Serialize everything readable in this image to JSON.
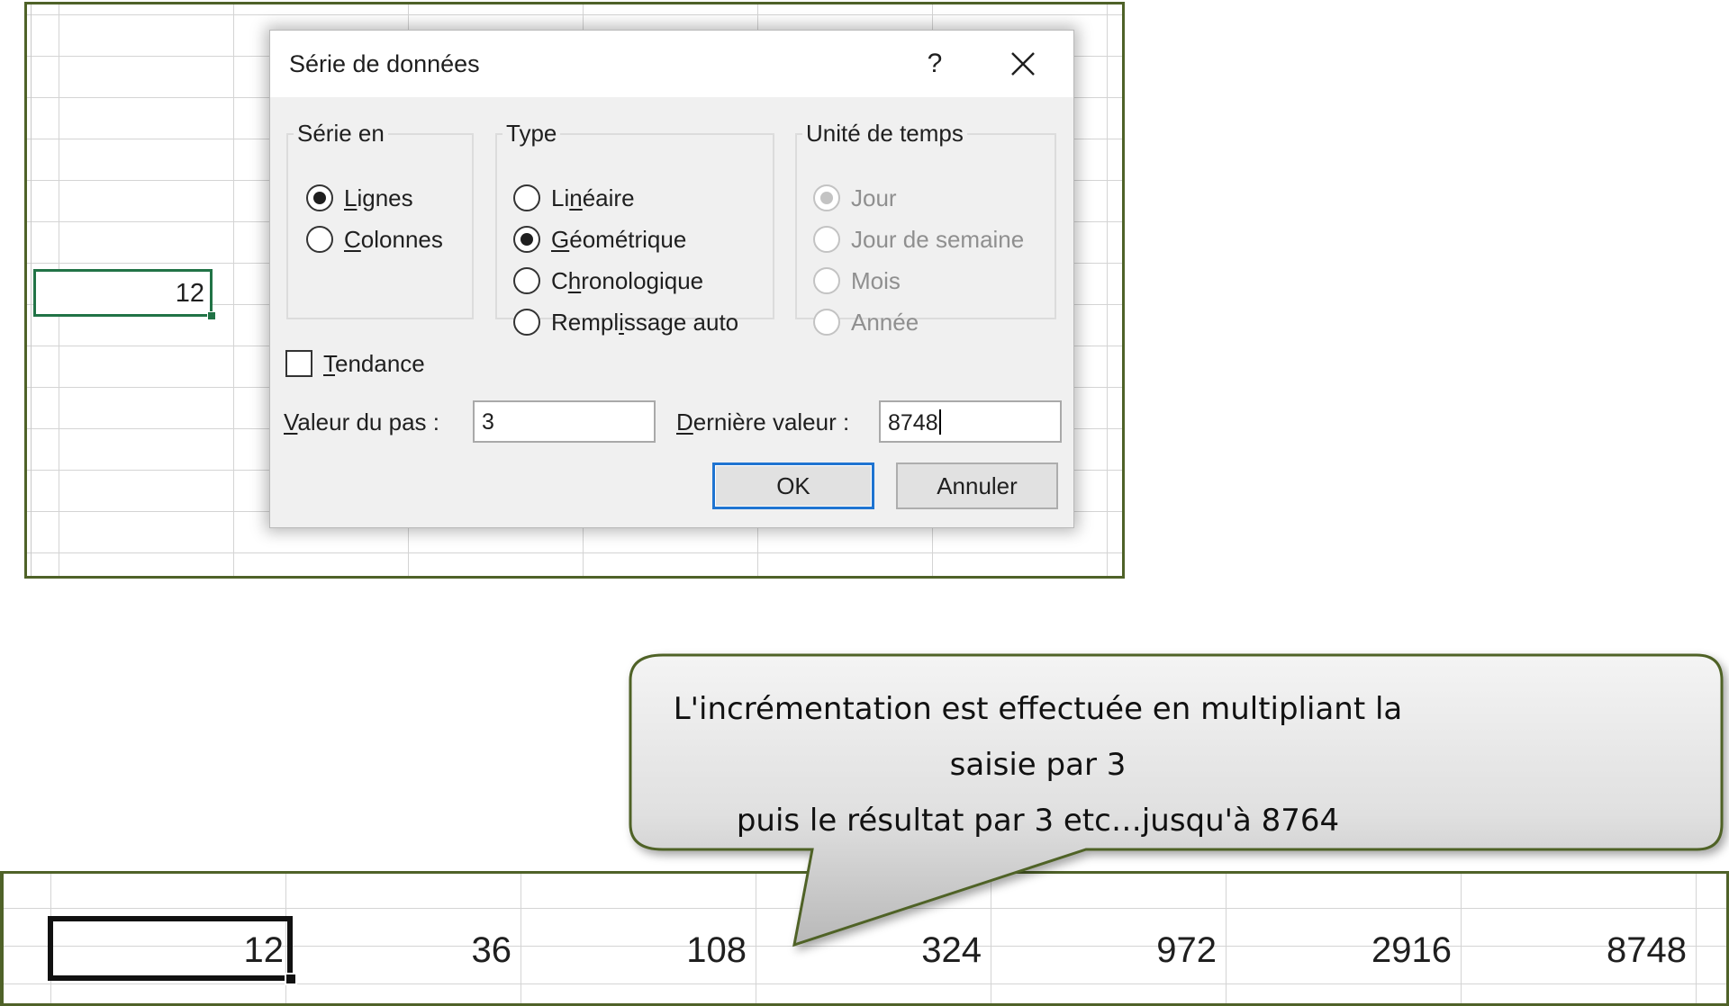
{
  "top_sheet": {
    "selected_cell_value": "12"
  },
  "dialog": {
    "title": "Série de données",
    "help_label": "?",
    "serie_en": {
      "legend": "Série en",
      "options": [
        {
          "pre": "",
          "key": "L",
          "post": "ignes",
          "checked": true
        },
        {
          "pre": "",
          "key": "C",
          "post": "olonnes",
          "checked": false
        }
      ]
    },
    "type": {
      "legend": "Type",
      "options": [
        {
          "pre": "Li",
          "key": "n",
          "post": "éaire",
          "checked": false
        },
        {
          "pre": "",
          "key": "G",
          "post": "éométrique",
          "checked": true
        },
        {
          "pre": "C",
          "key": "h",
          "post": "ronologique",
          "checked": false
        },
        {
          "pre": "Rempl",
          "key": "i",
          "post": "ssage auto",
          "checked": false
        }
      ]
    },
    "unite_de_temps": {
      "legend": "Unité de temps",
      "options": [
        {
          "label": "Jour",
          "checked": true
        },
        {
          "label": "Jour de semaine",
          "checked": false
        },
        {
          "label": "Mois",
          "checked": false
        },
        {
          "label": "Année",
          "checked": false
        }
      ]
    },
    "tendance": {
      "key": "T",
      "rest": "endance",
      "checked": false
    },
    "valeur_du_pas": {
      "key": "V",
      "rest": "aleur du pas :",
      "value": "3"
    },
    "derniere_valeur": {
      "key": "D",
      "rest": "ernière valeur :",
      "value": "8748"
    },
    "ok_label": "OK",
    "cancel_label": "Annuler"
  },
  "callout": {
    "line1": "L'incrémentation est effectuée en multipliant la saisie par 3",
    "line2": "puis le résultat par 3 etc…jusqu'à 8764"
  },
  "result_row": [
    "12",
    "36",
    "108",
    "324",
    "972",
    "2916",
    "8748"
  ],
  "colors": {
    "excel_green": "#217346",
    "frame_olive": "#4f6228",
    "callout_border": "#4f6228",
    "ok_focus_blue": "#1f74d1"
  }
}
